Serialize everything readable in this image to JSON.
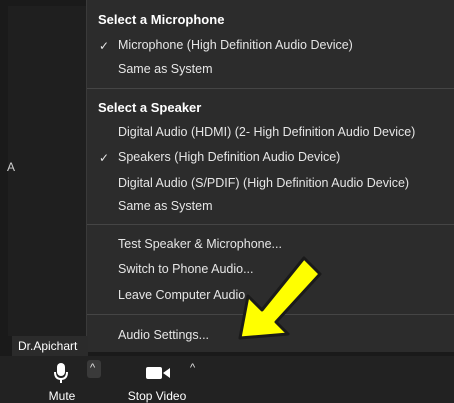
{
  "menu": {
    "microphone_title": "Select a Microphone",
    "microphone_items": [
      {
        "label": "Microphone (High Definition Audio Device)",
        "checked": true
      },
      {
        "label": "Same as System",
        "checked": false
      }
    ],
    "speaker_title": "Select a Speaker",
    "speaker_items": [
      {
        "label": "Digital Audio (HDMI) (2- High Definition Audio Device)",
        "checked": false
      },
      {
        "label": "Speakers (High Definition Audio Device)",
        "checked": true
      },
      {
        "label": "Digital Audio (S/PDIF) (High Definition Audio Device)",
        "checked": false
      },
      {
        "label": "Same as System",
        "checked": false
      }
    ],
    "actions": [
      "Test Speaker & Microphone...",
      "Switch to Phone Audio...",
      "Leave Computer Audio"
    ],
    "settings": "Audio Settings...",
    "check_glyph": "✓"
  },
  "participant": {
    "name": "Dr.Apichart"
  },
  "side_letter": "A",
  "toolbar": {
    "mute_label": "Mute",
    "video_label": "Stop Video",
    "caret_glyph": "^"
  },
  "arrow": {
    "color": "#ffff00",
    "outline": "#1a1a1a",
    "icon": "yellow-arrow-icon"
  }
}
